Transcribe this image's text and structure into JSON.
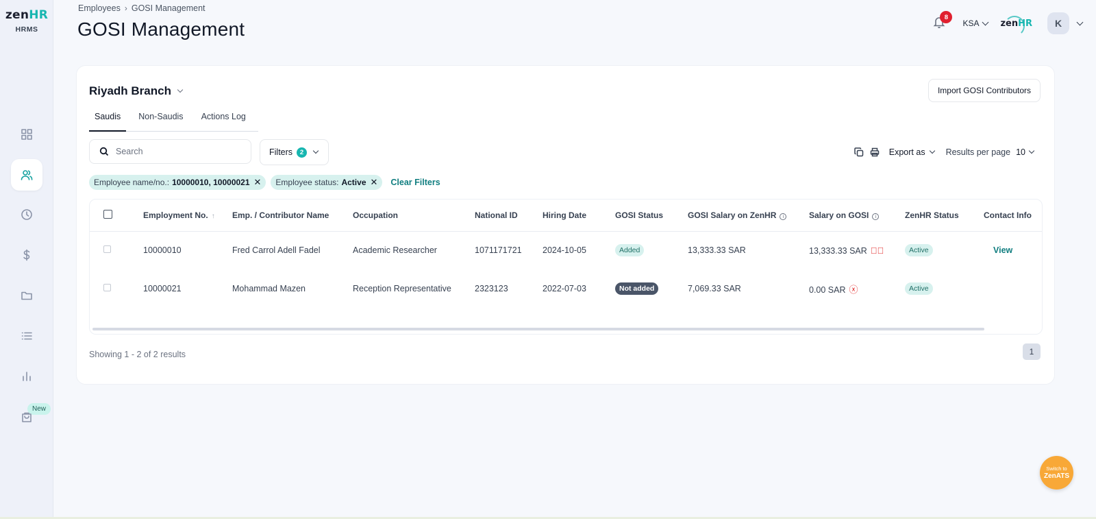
{
  "app": {
    "logo_text_a": "zen",
    "logo_text_b": "HR",
    "logo_sub": "HRMS",
    "brand_small_a": "zen",
    "brand_small_b": "HR"
  },
  "breadcrumb": {
    "parent": "Employees",
    "current": "GOSI Management"
  },
  "page_title": "GOSI Management",
  "topbar": {
    "notification_count": "8",
    "country": "KSA",
    "avatar_initial": "K"
  },
  "sidebar": {
    "items": [
      {
        "icon": "dashboard-icon",
        "active": false
      },
      {
        "icon": "people-icon",
        "active": true
      },
      {
        "icon": "clock-icon",
        "active": false
      },
      {
        "icon": "dollar-icon",
        "active": false
      },
      {
        "icon": "folder-icon",
        "active": false
      },
      {
        "icon": "list-icon",
        "active": false
      },
      {
        "icon": "bar-chart-icon",
        "active": false
      },
      {
        "icon": "shopping-bag-icon",
        "active": false
      }
    ],
    "new_badge": "New"
  },
  "branch": {
    "name": "Riyadh Branch"
  },
  "import_button": "Import GOSI Contributors",
  "tabs": [
    {
      "label": "Saudis",
      "active": true
    },
    {
      "label": "Non-Saudis",
      "active": false
    },
    {
      "label": "Actions Log",
      "active": false
    }
  ],
  "search": {
    "placeholder": "Search",
    "value": ""
  },
  "filters": {
    "label": "Filters",
    "count": "2"
  },
  "toolbar": {
    "export_label": "Export as",
    "results_per_page_label": "Results per page",
    "results_per_page_value": "10"
  },
  "active_filters": [
    {
      "key": "Employee name/no.:",
      "value": "10000010, 10000021"
    },
    {
      "key": "Employee status:",
      "value": "Active"
    }
  ],
  "clear_filters": "Clear Filters",
  "table": {
    "columns": [
      "Employment No.",
      "Emp. / Contributor Name",
      "Occupation",
      "National ID",
      "Hiring Date",
      "GOSI Status",
      "GOSI Salary on ZenHR",
      "Salary on GOSI",
      "ZenHR Status",
      "Contact Info"
    ],
    "rows": [
      {
        "employment_no": "10000010",
        "name": "Fred Carrol Adell Fadel",
        "occupation": "Academic Researcher",
        "national_id": "1071171721",
        "hiring_date": "2024-10-05",
        "gosi_status": "Added",
        "gosi_salary_zenhr": "13,333.33 SAR",
        "salary_on_gosi": "13,333.33 SAR",
        "salary_match": "check-circle-icon",
        "zenhr_status": "Active",
        "contact_info": "View"
      },
      {
        "employment_no": "10000021",
        "name": "Mohammad Mazen",
        "occupation": "Reception Representative",
        "national_id": "2323123",
        "hiring_date": "2022-07-03",
        "gosi_status": "Not added",
        "gosi_salary_zenhr": "7,069.33 SAR",
        "salary_on_gosi": "0.00 SAR",
        "salary_match": "x-circle-icon",
        "zenhr_status": "Active",
        "contact_info": ""
      }
    ]
  },
  "pagination": {
    "summary": "Showing 1 - 2 of 2 results",
    "current_page": "1"
  },
  "switch_button": {
    "line1": "Switch to",
    "line2": "ZenATS"
  },
  "colors": {
    "accent": "#17b6b0",
    "link": "#117e80",
    "danger": "#e02424",
    "fab": "#f8a837"
  }
}
